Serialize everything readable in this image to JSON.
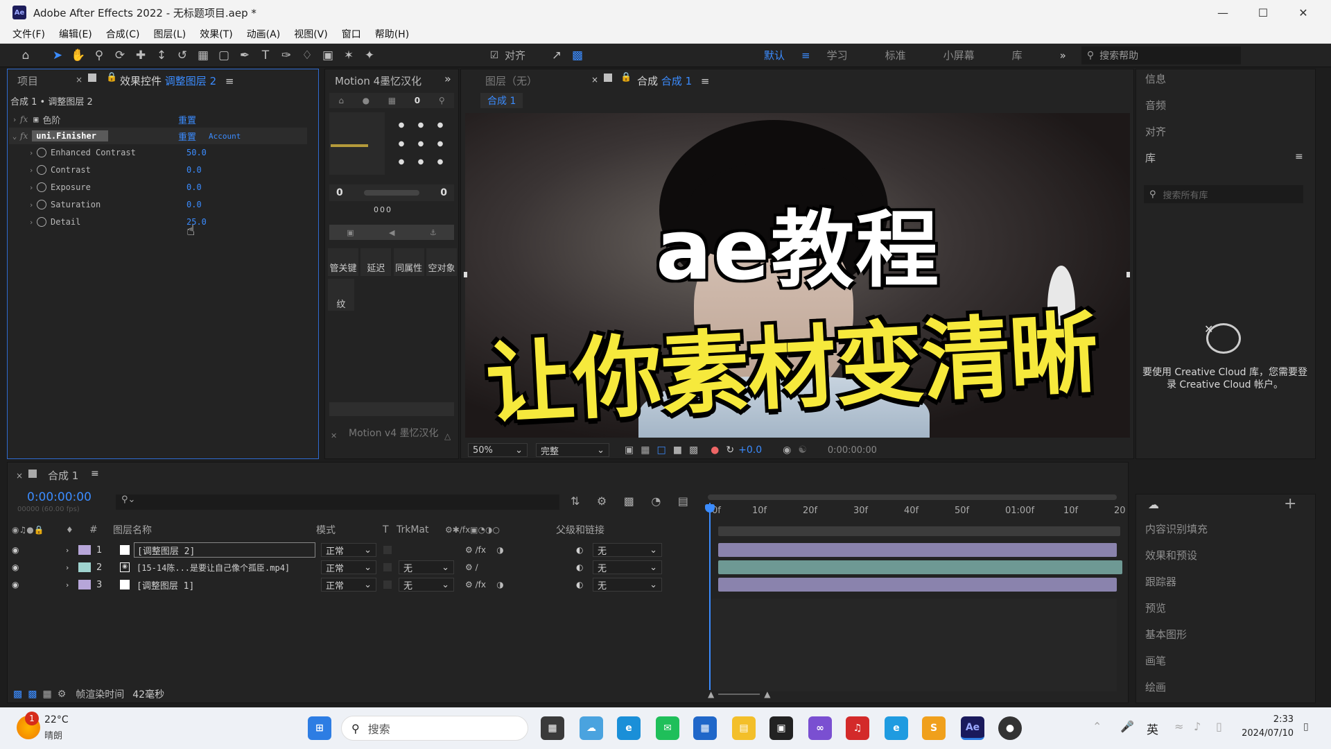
{
  "window": {
    "title": "Adobe After Effects 2022 - 无标题项目.aep *",
    "app_icon": "Ae"
  },
  "menu": [
    "文件(F)",
    "编辑(E)",
    "合成(C)",
    "图层(L)",
    "效果(T)",
    "动画(A)",
    "视图(V)",
    "窗口",
    "帮助(H)"
  ],
  "toolbar": {
    "align_label": "对齐",
    "workspaces": [
      "默认",
      "学习",
      "标准",
      "小屏幕",
      "库"
    ],
    "search_placeholder": "搜索帮助"
  },
  "effects_panel": {
    "tab_project": "项目",
    "tab_effects": "效果控件",
    "tab_effects_layer": "调整图层 2",
    "breadcrumb": "合成 1 • 调整图层 2",
    "effects": [
      {
        "name": "色阶",
        "reset": "重置"
      },
      {
        "name": "uni.Finisher",
        "reset": "重置",
        "account": "Account"
      }
    ],
    "params": [
      {
        "name": "Enhanced Contrast",
        "value": "50.0"
      },
      {
        "name": "Contrast",
        "value": "0.0"
      },
      {
        "name": "Exposure",
        "value": "0.0"
      },
      {
        "name": "Saturation",
        "value": "0.0"
      },
      {
        "name": "Detail",
        "value": "25.0"
      }
    ]
  },
  "motion_panel": {
    "title": "Motion 4墨忆汉化",
    "num_a": "0",
    "num_b": "0",
    "num_c": "0",
    "dots": "000",
    "buttons": [
      "管关键",
      "延迟",
      "同属性",
      "空对象"
    ],
    "btn_wen": "纹",
    "footer": "Motion v4 墨忆汉化"
  },
  "viewer": {
    "tab_layer": "图层（无）",
    "tab_comp_prefix": "合成",
    "tab_comp_name": "合成 1",
    "comp_chip": "合成 1",
    "overlay_line1": "ae教程",
    "overlay_line2": "让你素材变清晰",
    "zoom": "50%",
    "quality": "完整",
    "exposure": "+0.0",
    "timecode": "0:00:00:00"
  },
  "timeline": {
    "tab": "合成 1",
    "timecode": "0:00:00:00",
    "sub_timecode": "00000 (60.00 fps)",
    "columns": {
      "num": "#",
      "name": "图层名称",
      "mode": "模式",
      "t": "T",
      "trkmat": "TrkMat",
      "parent": "父级和链接"
    },
    "ruler": [
      "0f",
      "10f",
      "20f",
      "30f",
      "40f",
      "50f",
      "01:00f",
      "10f",
      "20"
    ],
    "layers": [
      {
        "num": "1",
        "name": "[调整图层 2]",
        "mode": "正常",
        "trkmat": "",
        "parent": "无",
        "color": "#b7a6d9"
      },
      {
        "num": "2",
        "name": "[15-14陈...是要让自己像个孤臣.mp4]",
        "mode": "正常",
        "trkmat": "无",
        "parent": "无",
        "color": "#9fd3cf"
      },
      {
        "num": "3",
        "name": "[调整图层 1]",
        "mode": "正常",
        "trkmat": "无",
        "parent": "无",
        "color": "#b7a6d9"
      }
    ],
    "render_label": "帧渲染时间",
    "render_value": "42毫秒"
  },
  "right_panel": {
    "top_items": [
      "信息",
      "音频",
      "对齐"
    ],
    "library_title": "库",
    "library_search": "搜索所有库",
    "cc_message": "要使用 Creative Cloud 库，您需要登录 Creative Cloud 帐户。",
    "bottom_items": [
      "内容识别填充",
      "效果和预设",
      "跟踪器",
      "预览",
      "基本图形",
      "画笔",
      "绘画"
    ]
  },
  "taskbar": {
    "weather_temp": "22°C",
    "weather_desc": "晴朗",
    "weather_badge": "1",
    "search": "搜索",
    "ae_label": "Ae",
    "ime": "英",
    "time": "2:33",
    "date": "2024/07/10"
  },
  "colors": {
    "accent": "#3b8cff",
    "caption_yellow": "#f6e93c",
    "panel_bg": "#232323"
  }
}
